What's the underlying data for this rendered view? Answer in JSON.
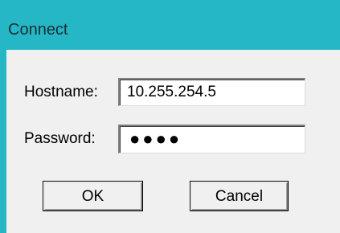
{
  "window": {
    "title": "Connect"
  },
  "form": {
    "hostname_label": "Hostname:",
    "hostname_value": "10.255.254.5",
    "password_label": "Password:",
    "password_masked": "●●●●"
  },
  "buttons": {
    "ok_label": "OK",
    "cancel_label": "Cancel"
  },
  "colors": {
    "titlebar": "#25b7c6",
    "dialog_background": "#f0f0f0"
  }
}
